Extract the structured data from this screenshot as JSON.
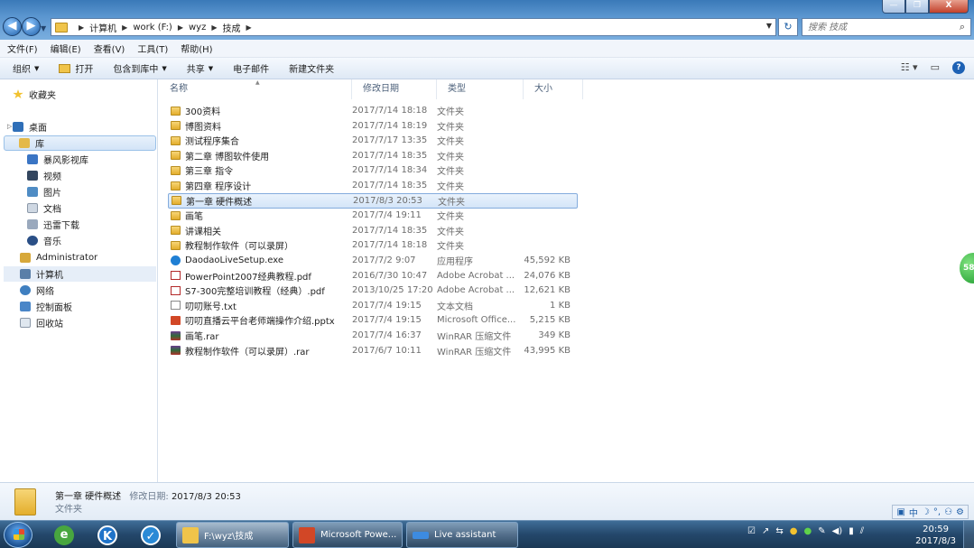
{
  "window": {
    "minimize_label": "—",
    "maximize_label": "❐",
    "close_label": "X"
  },
  "nav": {
    "back_label": "◀",
    "forward_label": "▶"
  },
  "address": {
    "crumbs": [
      "计算机",
      "work (F:)",
      "wyz",
      "技成"
    ],
    "refresh_label": "↻",
    "search_placeholder": "搜索 技成"
  },
  "menu": [
    "文件(F)",
    "编辑(E)",
    "查看(V)",
    "工具(T)",
    "帮助(H)"
  ],
  "toolbar": {
    "organize": "组织",
    "open": "打开",
    "include_library": "包含到库中",
    "share": "共享",
    "email": "电子邮件",
    "new_folder": "新建文件夹",
    "help": "?"
  },
  "sidebar": {
    "favorites": "收藏夹",
    "desktop": "桌面",
    "library": "库",
    "lib_items": [
      "暴风影视库",
      "视频",
      "图片",
      "文档",
      "迅雷下载",
      "音乐"
    ],
    "admin": "Administrator",
    "computer": "计算机",
    "network": "网络",
    "control_panel": "控制面板",
    "recycle": "回收站"
  },
  "columns": {
    "name": "名称",
    "date": "修改日期",
    "type": "类型",
    "size": "大小"
  },
  "files": [
    {
      "name": "300资料",
      "date": "2017/7/14 18:18",
      "type": "文件夹",
      "size": "",
      "icon": "folder"
    },
    {
      "name": "博图资料",
      "date": "2017/7/14 18:19",
      "type": "文件夹",
      "size": "",
      "icon": "folder"
    },
    {
      "name": "测试程序集合",
      "date": "2017/7/17 13:35",
      "type": "文件夹",
      "size": "",
      "icon": "folder"
    },
    {
      "name": "第二章 博图软件使用",
      "date": "2017/7/14 18:35",
      "type": "文件夹",
      "size": "",
      "icon": "folder"
    },
    {
      "name": "第三章 指令",
      "date": "2017/7/14 18:34",
      "type": "文件夹",
      "size": "",
      "icon": "folder"
    },
    {
      "name": "第四章 程序设计",
      "date": "2017/7/14 18:35",
      "type": "文件夹",
      "size": "",
      "icon": "folder"
    },
    {
      "name": "第一章 硬件概述",
      "date": "2017/8/3 20:53",
      "type": "文件夹",
      "size": "",
      "icon": "folder"
    },
    {
      "name": "画笔",
      "date": "2017/7/4 19:11",
      "type": "文件夹",
      "size": "",
      "icon": "folder"
    },
    {
      "name": "讲课相关",
      "date": "2017/7/14 18:35",
      "type": "文件夹",
      "size": "",
      "icon": "folder"
    },
    {
      "name": "教程制作软件（可以录屏）",
      "date": "2017/7/14 18:18",
      "type": "文件夹",
      "size": "",
      "icon": "folder"
    },
    {
      "name": "DaodaoLiveSetup.exe",
      "date": "2017/7/2 9:07",
      "type": "应用程序",
      "size": "45,592 KB",
      "icon": "exe"
    },
    {
      "name": "PowerPoint2007经典教程.pdf",
      "date": "2016/7/30 10:47",
      "type": "Adobe Acrobat ...",
      "size": "24,076 KB",
      "icon": "pdf"
    },
    {
      "name": "S7-300完整培训教程（经典）.pdf",
      "date": "2013/10/25 17:20",
      "type": "Adobe Acrobat ...",
      "size": "12,621 KB",
      "icon": "pdf"
    },
    {
      "name": "叨叨账号.txt",
      "date": "2017/7/4 19:15",
      "type": "文本文档",
      "size": "1 KB",
      "icon": "txt"
    },
    {
      "name": "叨叨直播云平台老师端操作介绍.pptx",
      "date": "2017/7/4 19:15",
      "type": "Microsoft Office...",
      "size": "5,215 KB",
      "icon": "pptx"
    },
    {
      "name": "画笔.rar",
      "date": "2017/7/4 16:37",
      "type": "WinRAR 压缩文件",
      "size": "349 KB",
      "icon": "rar"
    },
    {
      "name": "教程制作软件（可以录屏）.rar",
      "date": "2017/6/7 10:11",
      "type": "WinRAR 压缩文件",
      "size": "43,995 KB",
      "icon": "rar"
    }
  ],
  "selected_index": 6,
  "details": {
    "name": "第一章 硬件概述",
    "modified_label": "修改日期:",
    "modified": "2017/8/3 20:53",
    "type": "文件夹"
  },
  "ime": [
    "中",
    "☽",
    "°,",
    "⚇",
    "⚙"
  ],
  "bubble_text": "58",
  "taskbar": {
    "tasks": [
      {
        "label": "F:\\wyz\\技成",
        "color": "#f0c44a"
      },
      {
        "label": "Microsoft Powe...",
        "color": "#d24726"
      },
      {
        "label": "Live assistant",
        "color": "#3d8be0"
      }
    ],
    "clock_time": "20:59",
    "clock_date": "2017/8/3"
  }
}
